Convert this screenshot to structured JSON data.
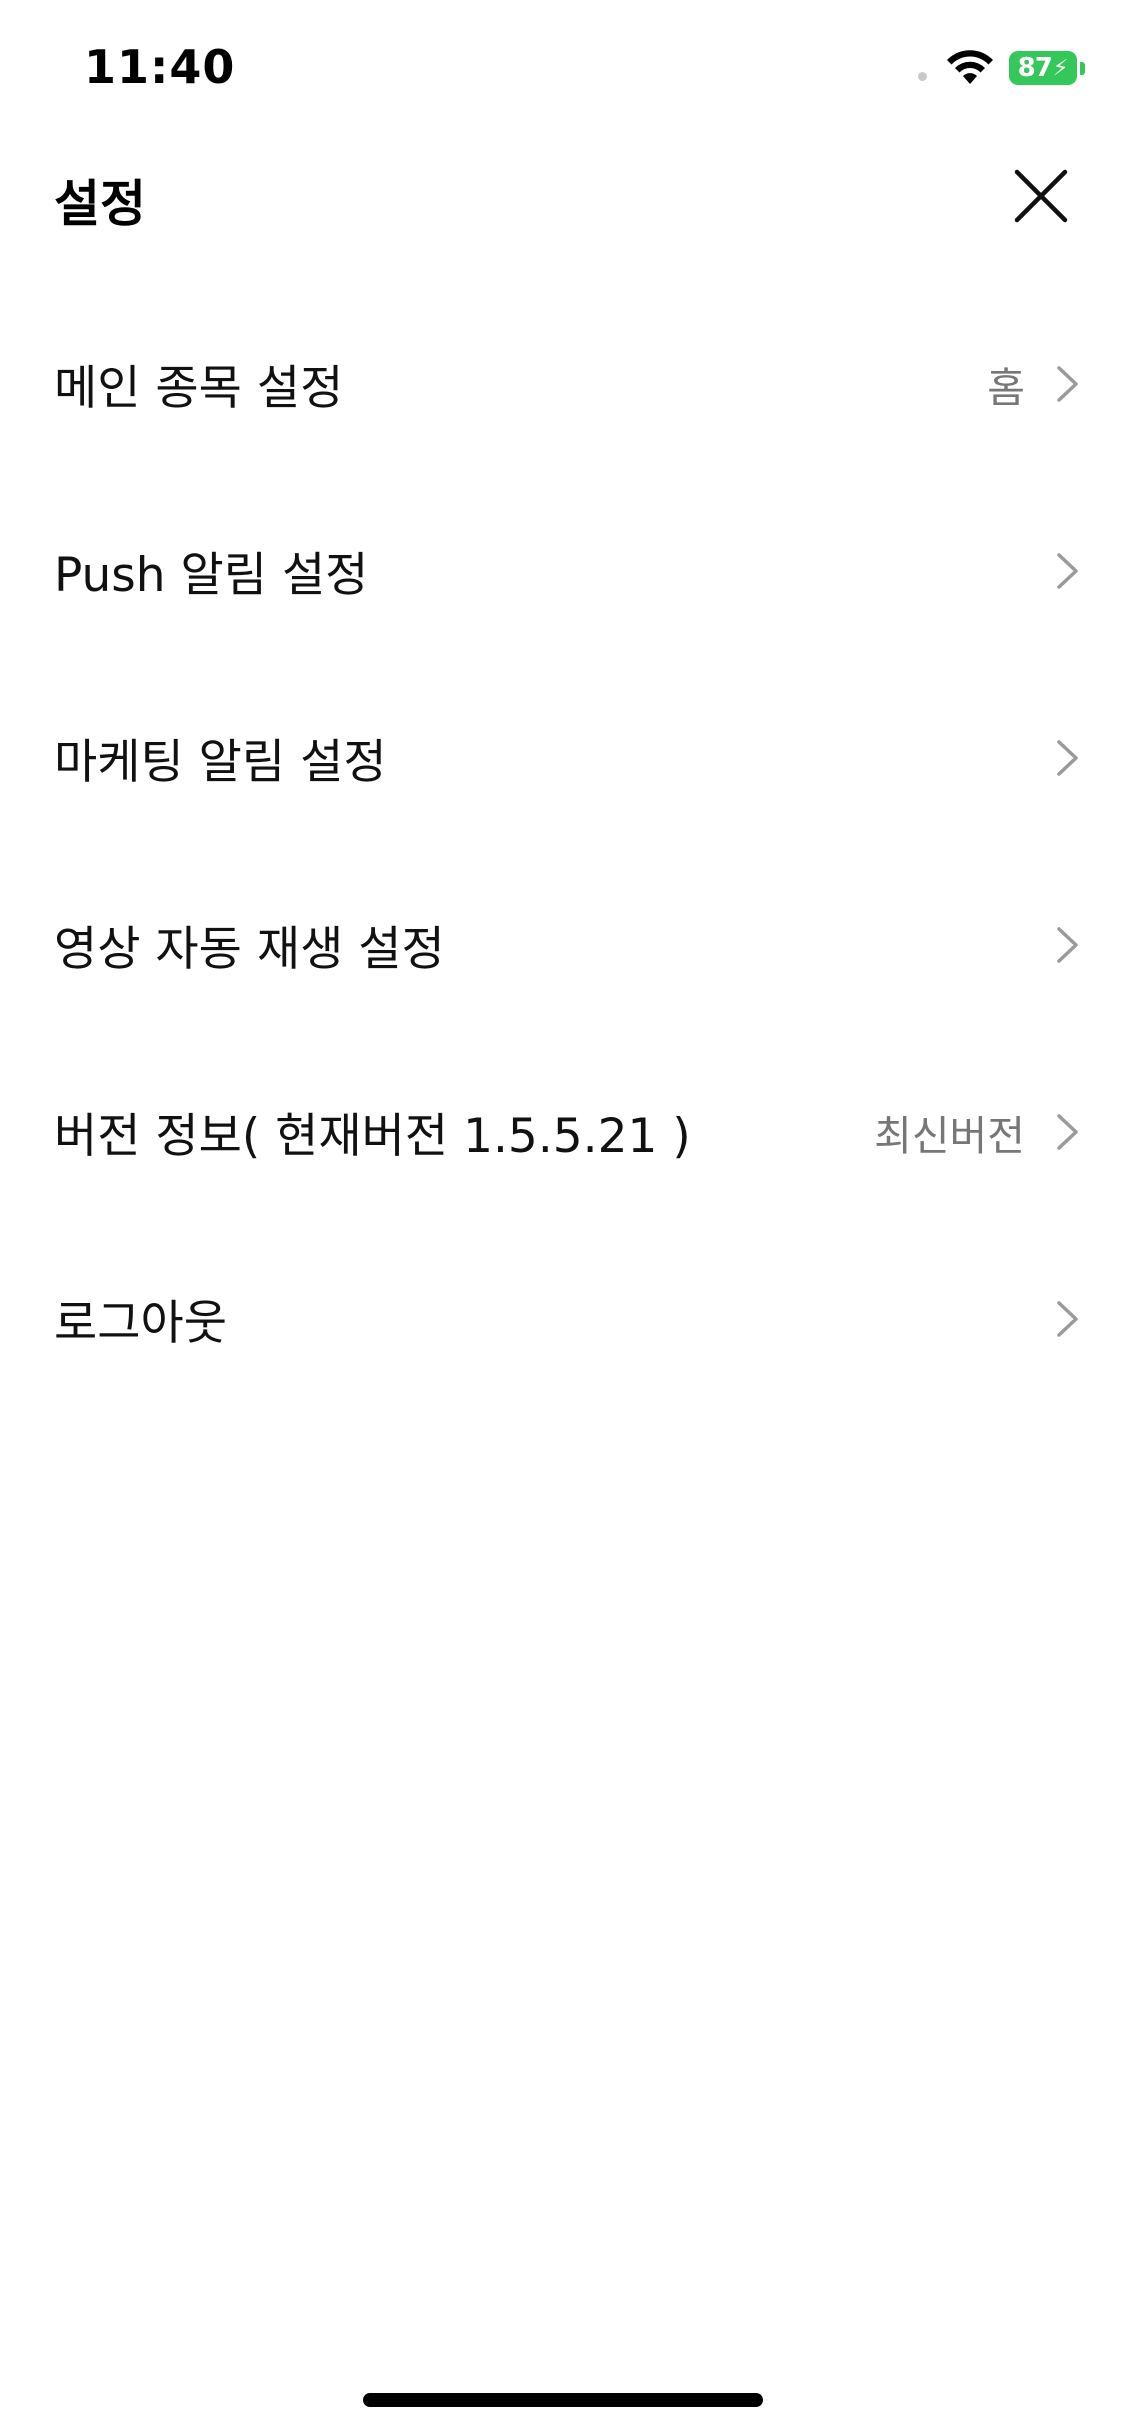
{
  "status_bar": {
    "time": "11:40",
    "battery_level": "87",
    "battery_color": "#34c759"
  },
  "header": {
    "title": "설정",
    "close_icon": "close-icon"
  },
  "settings": [
    {
      "label": "메인 종목 설정",
      "value": "홈",
      "icon": "chevron-right-icon"
    },
    {
      "label": "Push 알림 설정",
      "value": "",
      "icon": "chevron-right-icon"
    },
    {
      "label": "마케팅 알림 설정",
      "value": "",
      "icon": "chevron-right-icon"
    },
    {
      "label": "영상 자동 재생 설정",
      "value": "",
      "icon": "chevron-right-icon"
    },
    {
      "label": "버전 정보( 현재버전 1.5.5.21 )",
      "value": "최신버전",
      "icon": "chevron-right-icon"
    },
    {
      "label": "로그아웃",
      "value": "",
      "icon": "chevron-right-icon"
    }
  ]
}
